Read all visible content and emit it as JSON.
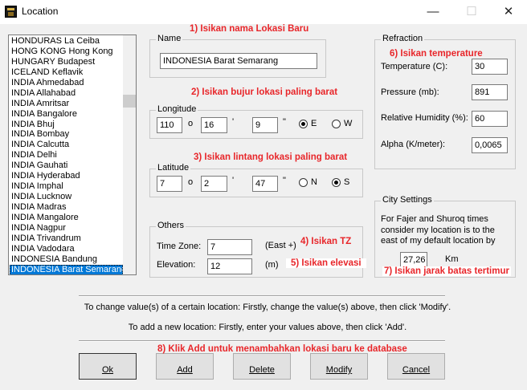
{
  "window": {
    "title": "Location"
  },
  "locations": [
    "HONDURAS La Ceiba",
    "HONG KONG Hong Kong",
    "HUNGARY Budapest",
    "ICELAND Keflavik",
    "INDIA Ahmedabad",
    "INDIA Allahabad",
    "INDIA Amritsar",
    "INDIA Bangalore",
    "INDIA Bhuj",
    "INDIA Bombay",
    "INDIA Calcutta",
    "INDIA Delhi",
    "INDIA Gauhati",
    "INDIA Hyderabad",
    "INDIA Imphal",
    "INDIA Lucknow",
    "INDIA Madras",
    "INDIA Mangalore",
    "INDIA Nagpur",
    "INDIA Trivandrum",
    "INDIA Vadodara",
    "INDONESIA Bandung",
    "INDONESIA Barat Semarang"
  ],
  "selected_location": "INDONESIA Barat Semarang",
  "name": {
    "label": "Name",
    "value": "INDONESIA Barat Semarang"
  },
  "longitude": {
    "label": "Longitude",
    "deg": "110",
    "deg_symbol": "o",
    "min": "16",
    "min_symbol": "'",
    "sec": "9",
    "sec_symbol": "\"",
    "dir_e": "E",
    "dir_w": "W",
    "selected": "E"
  },
  "latitude": {
    "label": "Latitude",
    "deg": "7",
    "deg_symbol": "o",
    "min": "2",
    "min_symbol": "'",
    "sec": "47",
    "sec_symbol": "\"",
    "dir_n": "N",
    "dir_s": "S",
    "selected": "S"
  },
  "others": {
    "label": "Others",
    "timezone_label": "Time Zone:",
    "timezone_value": "7",
    "timezone_unit": "(East +)",
    "elevation_label": "Elevation:",
    "elevation_value": "12",
    "elevation_unit": "(m)"
  },
  "refraction": {
    "label": "Refraction",
    "temperature_label": "Temperature (C):",
    "temperature_value": "30",
    "pressure_label": "Pressure (mb):",
    "pressure_value": "891",
    "humidity_label": "Relative Humidity (%):",
    "humidity_value": "60",
    "alpha_label": "Alpha (K/meter):",
    "alpha_value": "0,0065"
  },
  "city_settings": {
    "label": "City Settings",
    "line1": "For Fajer and Shuroq times",
    "line2": "consider my location is to the",
    "line3": "east of my default location by",
    "distance_value": "27,26",
    "distance_unit": "Km"
  },
  "info": {
    "line1": "To change value(s) of a certain location: Firstly, change the value(s) above, then click 'Modify'.",
    "line2": "To add a new location: Firstly, enter your values above, then click  'Add'."
  },
  "buttons": {
    "ok": "Ok",
    "add": "Add",
    "delete": "Delete",
    "modify": "Modify",
    "cancel": "Cancel"
  },
  "annotations": {
    "a1": "1) Isikan nama Lokasi Baru",
    "a2": "2) Isikan bujur lokasi paling barat",
    "a3": "3) Isikan lintang lokasi paling barat",
    "a4": "4) Isikan TZ",
    "a5": "5) Isikan elevasi",
    "a6": "6) Isikan temperature",
    "a7": "7) Isikan jarak batas tertimur",
    "a8": "8) Klik Add untuk menambahkan lokasi baru ke database"
  },
  "colors": {
    "annotation": "#e8262a",
    "selection": "#0078d7",
    "dialog_bg": "#f0f0f0"
  }
}
